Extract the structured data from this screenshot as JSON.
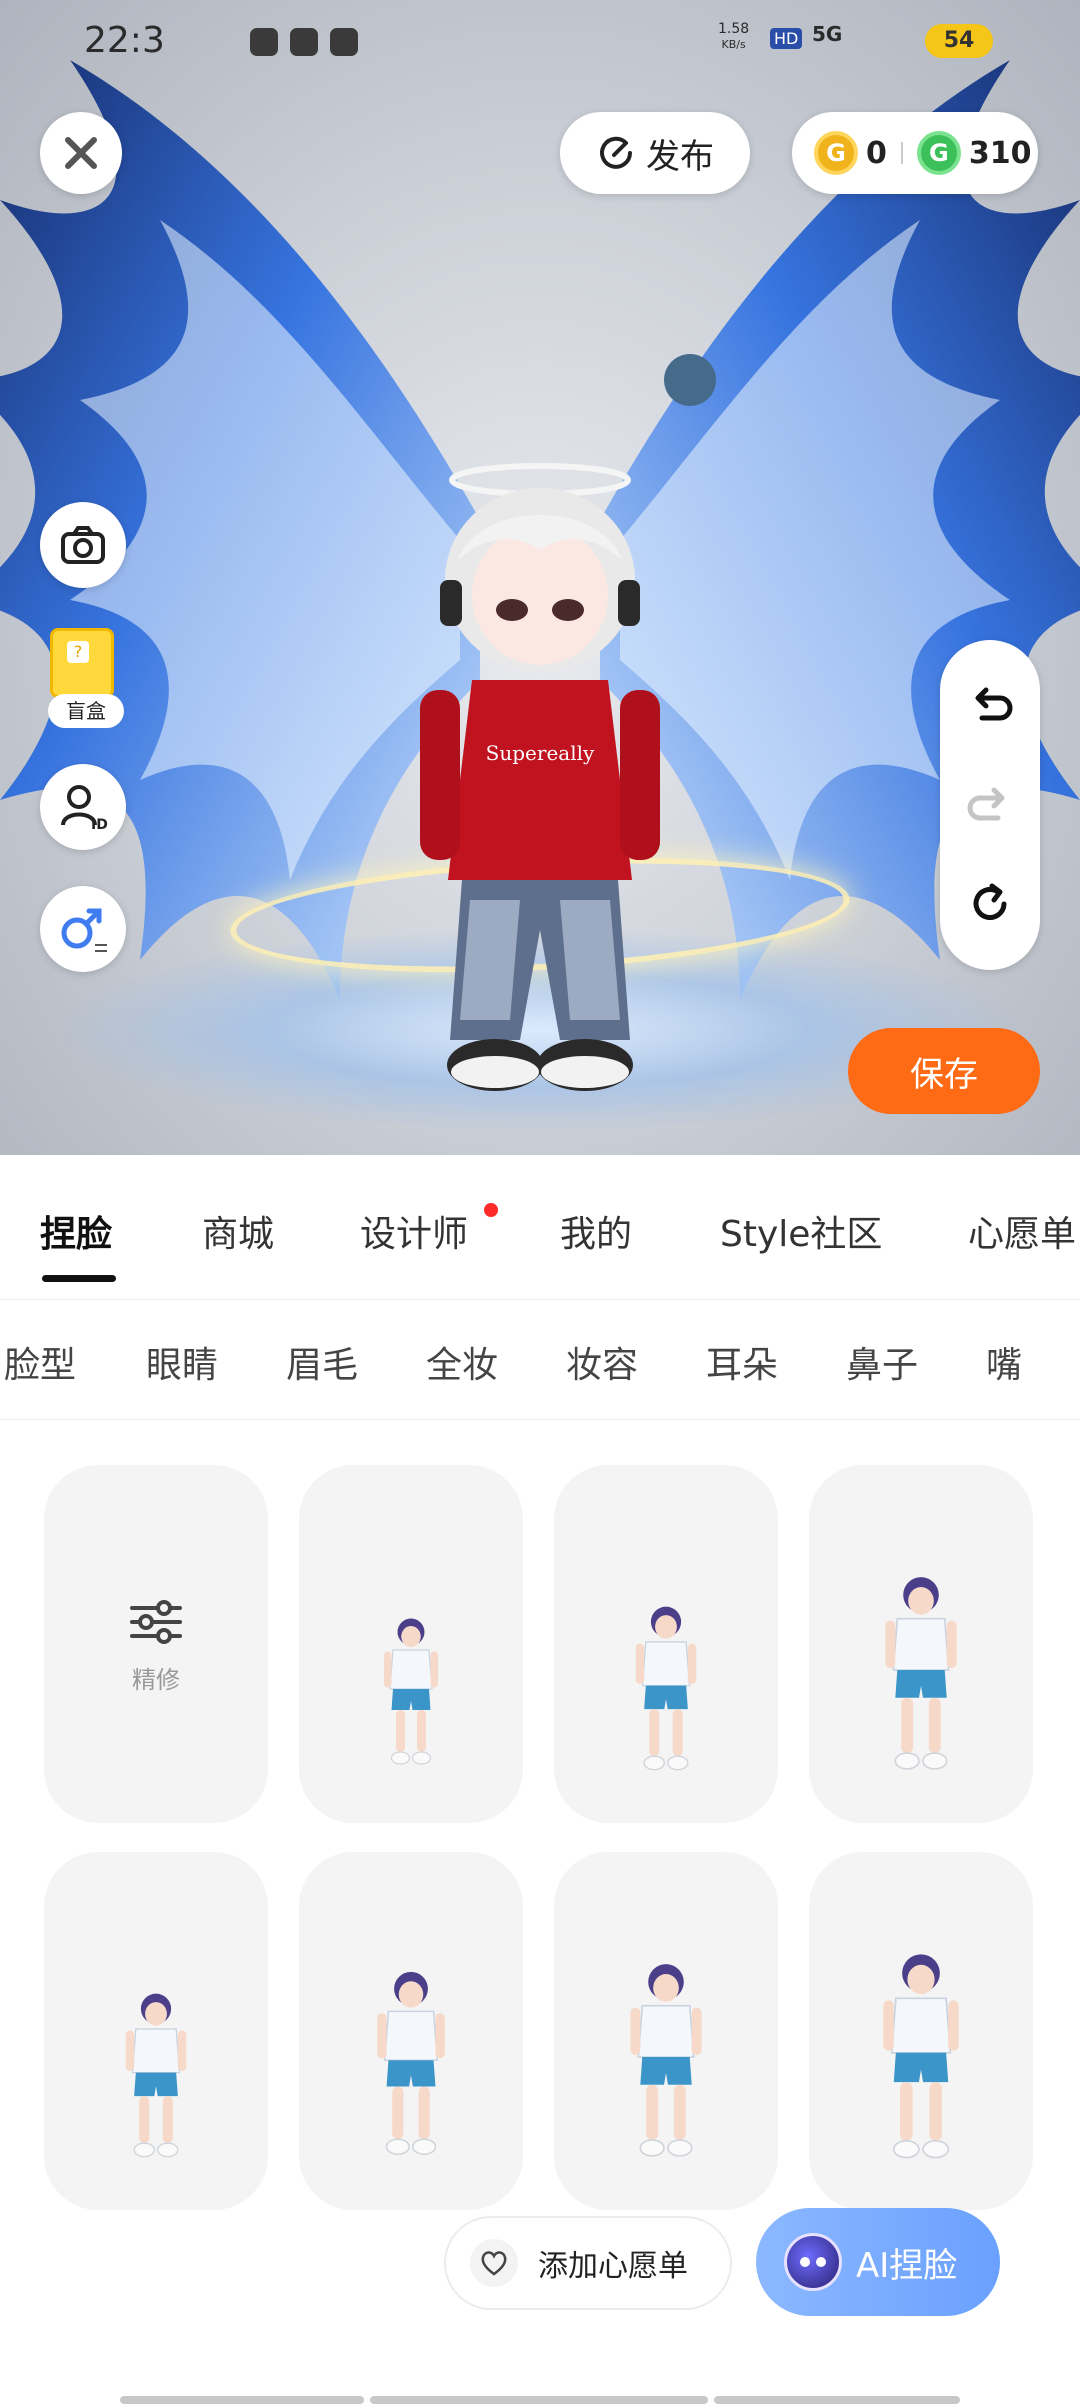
{
  "status_bar": {
    "time": "22:3",
    "net_speed": "1.58",
    "net_unit": "KB/s",
    "hd": "HD",
    "network": "5G",
    "battery": "54"
  },
  "top_actions": {
    "publish_label": "发布",
    "gold_count": "0",
    "green_count": "310"
  },
  "avatar": {
    "hoodie_text": "Supereally"
  },
  "side_tools": {
    "blind_box_label": "盲盒"
  },
  "save_label": "保存",
  "main_tabs": [
    {
      "label": "捏脸",
      "active": true
    },
    {
      "label": "商城",
      "active": false
    },
    {
      "label": "设计师",
      "active": false,
      "dot": true
    },
    {
      "label": "我的",
      "active": false
    },
    {
      "label": "Style社区",
      "active": false
    },
    {
      "label": "心愿单",
      "active": false
    }
  ],
  "sub_tabs": [
    "脸型",
    "眼睛",
    "眉毛",
    "全妆",
    "妆容",
    "耳朵",
    "鼻子",
    "嘴"
  ],
  "refine_label": "精修",
  "wish_button_label": "添加心愿单",
  "ai_button_label": "AI捏脸",
  "colors": {
    "accent_orange": "#ff6a14",
    "wing_blue": "#2f6fe0",
    "hoodie_red": "#c1121f",
    "ai_blue": "#6aa0ff"
  }
}
